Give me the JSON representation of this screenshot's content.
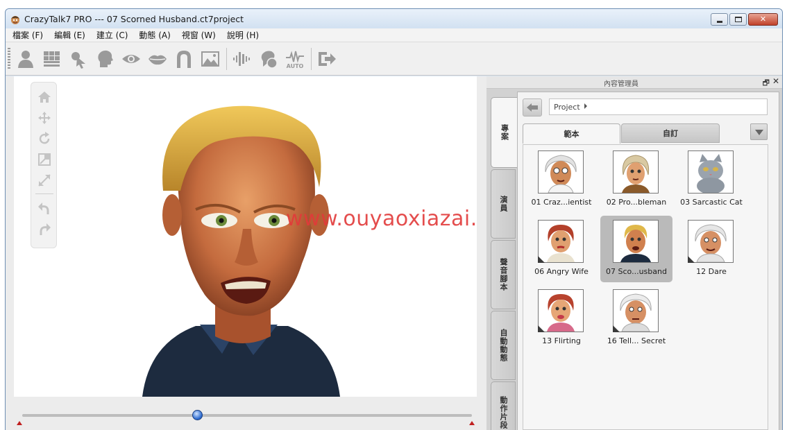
{
  "window": {
    "title": "CrazyTalk7 PRO --- 07 Scorned Husband.ct7project",
    "controls": {
      "minimize": "",
      "maximize": "",
      "close": "✕"
    }
  },
  "menu": [
    "檔案 (F)",
    "編輯 (E)",
    "建立 (C)",
    "動態 (A)",
    "視窗 (W)",
    "說明 (H)"
  ],
  "toolbar": {
    "auto_label": "AUTO"
  },
  "viewport": {
    "watermark": "www.ouyaoxiazai.com",
    "timeline_position": 0.39
  },
  "content_manager": {
    "title": "內容管理員",
    "restore_glyph": "🗗",
    "close_glyph": "✕",
    "side_tabs": [
      "專案",
      "演員",
      "聲音腳本",
      "自動動態",
      "動作片段"
    ],
    "active_side_tab": 0,
    "path": "Project",
    "tabs": [
      "範本",
      "自訂"
    ],
    "active_tab": 0,
    "items": [
      {
        "label": "01 Craz...ientist",
        "selected": false
      },
      {
        "label": "02 Pro...bleman",
        "selected": false
      },
      {
        "label": "03 Sarcastic Cat",
        "selected": false
      },
      {
        "label": "06 Angry Wife",
        "selected": false
      },
      {
        "label": "07 Sco...usband",
        "selected": true
      },
      {
        "label": "12 Dare",
        "selected": false
      },
      {
        "label": "13 Flirting",
        "selected": false
      },
      {
        "label": "16 Tell... Secret",
        "selected": false
      }
    ]
  },
  "colors": {
    "accent": "#2e6cd0",
    "watermark": "#e23a3a",
    "selected_item": "#bababa"
  }
}
